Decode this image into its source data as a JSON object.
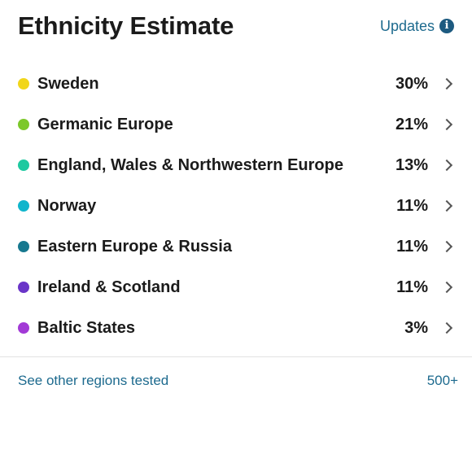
{
  "header": {
    "title": "Ethnicity Estimate",
    "updates_label": "Updates",
    "info_glyph": "i"
  },
  "regions": [
    {
      "name": "Sweden",
      "percent": "30%",
      "color": "#f1d61a"
    },
    {
      "name": "Germanic Europe",
      "percent": "21%",
      "color": "#7cc82a"
    },
    {
      "name": "England, Wales & Northwestern Europe",
      "percent": "13%",
      "color": "#1ec9a0"
    },
    {
      "name": "Norway",
      "percent": "11%",
      "color": "#10b5cc"
    },
    {
      "name": "Eastern Europe & Russia",
      "percent": "11%",
      "color": "#17788f"
    },
    {
      "name": "Ireland & Scotland",
      "percent": "11%",
      "color": "#6a35c8"
    },
    {
      "name": "Baltic States",
      "percent": "3%",
      "color": "#a23ad6"
    }
  ],
  "footer": {
    "see_other_label": "See other regions tested",
    "other_count": "500+"
  },
  "icons": {
    "info": "info-icon",
    "chevron": "chevron-right-icon"
  },
  "colors": {
    "link": "#1d6a8e",
    "info_icon_bg": "#1d5a80",
    "divider": "#e2e2e2"
  }
}
